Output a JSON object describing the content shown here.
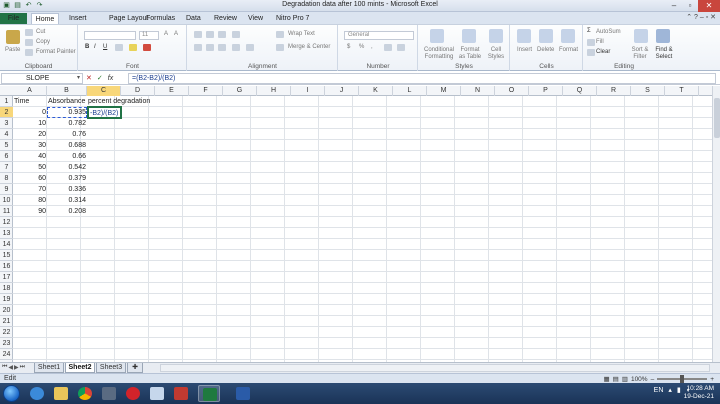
{
  "window": {
    "title": "Degradation data after 100 mints  -  Microsoft Excel"
  },
  "tabs": [
    "File",
    "Home",
    "Insert",
    "Page Layout",
    "Formulas",
    "Data",
    "Review",
    "View",
    "Nitro Pro 7"
  ],
  "ribbon": {
    "clipboard": {
      "label": "Clipboard",
      "paste": "Paste",
      "cut": "Cut",
      "copy": "Copy",
      "format_painter": "Format Painter"
    },
    "font": {
      "label": "Font",
      "size": "11",
      "bold": "B",
      "italic": "I",
      "underline": "U"
    },
    "alignment": {
      "label": "Alignment",
      "wrap_text": "Wrap Text",
      "merge_center": "Merge & Center"
    },
    "number": {
      "label": "Number",
      "format": "General",
      "currency": "$",
      "percent": "%"
    },
    "styles": {
      "label": "Styles",
      "conditional": "Conditional Formatting",
      "format_table": "Format as Table",
      "cell_styles": "Cell Styles"
    },
    "cells": {
      "label": "Cells",
      "insert": "Insert",
      "delete": "Delete",
      "format": "Format"
    },
    "editing": {
      "label": "Editing",
      "autosum": "AutoSum",
      "fill": "Fill",
      "clear": "Clear",
      "sort_filter": "Sort & Filter",
      "find_select": "Find & Select"
    }
  },
  "formula_bar": {
    "name_box": "SLOPE",
    "cancel": "✕",
    "enter": "✓",
    "fx": "fx",
    "formula": "=(B2-B2)/(B2)"
  },
  "columns": [
    "A",
    "B",
    "C",
    "D",
    "E",
    "F",
    "G",
    "H",
    "I",
    "J",
    "K",
    "L",
    "M",
    "N",
    "O",
    "P",
    "Q",
    "R",
    "S",
    "T"
  ],
  "rows": [
    "1",
    "2",
    "3",
    "4",
    "5",
    "6",
    "7",
    "8",
    "9",
    "10",
    "11",
    "12",
    "13",
    "14",
    "15",
    "16",
    "17",
    "18",
    "19",
    "20",
    "21",
    "22",
    "23",
    "24"
  ],
  "sheet": {
    "headers": {
      "a1": "Time",
      "b1": "Absorbance",
      "c1": "percent degradation"
    },
    "time": [
      "0",
      "10",
      "20",
      "30",
      "40",
      "50",
      "60",
      "70",
      "80",
      "90"
    ],
    "absorbance": [
      "0.935",
      "0.782",
      "0.76",
      "0.688",
      "0.66",
      "0.542",
      "0.379",
      "0.336",
      "0.314",
      "0.208"
    ],
    "editing_text": "-B2)/(B2)"
  },
  "sheet_tabs": [
    "Sheet1",
    "Sheet2",
    "Sheet3"
  ],
  "status": {
    "mode": "Edit",
    "zoom": "100%"
  },
  "taskbar": {
    "tray_lang": "EN",
    "time": "10:28 AM",
    "date": "19-Dec-21"
  }
}
